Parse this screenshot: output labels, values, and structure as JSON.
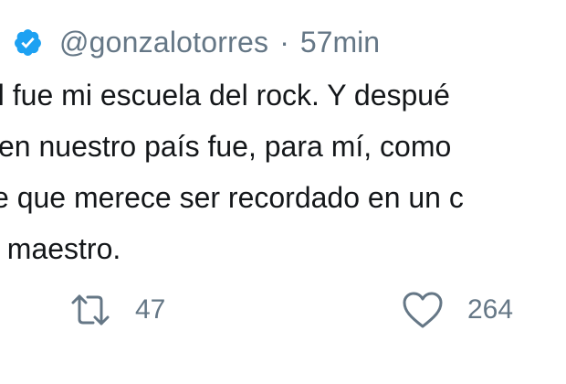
{
  "tweet": {
    "handle": "@gonzalotorres",
    "separator": "·",
    "time": "57min",
    "lines": [
      {
        "bold": "l",
        "text": " fue mi escuela del rock. Y despué"
      },
      {
        "text": "en nuestro país fue, para mí, como"
      },
      {
        "text": "e que merece ser recordado en un c"
      },
      {
        "text": ", maestro."
      }
    ],
    "actions": {
      "retweet_icon": "retweet-icon",
      "retweet_count": "47",
      "like_icon": "heart-icon",
      "like_count": "264"
    },
    "colors": {
      "verified": "#1da1f2",
      "muted": "#657786",
      "text": "#14171a"
    }
  }
}
